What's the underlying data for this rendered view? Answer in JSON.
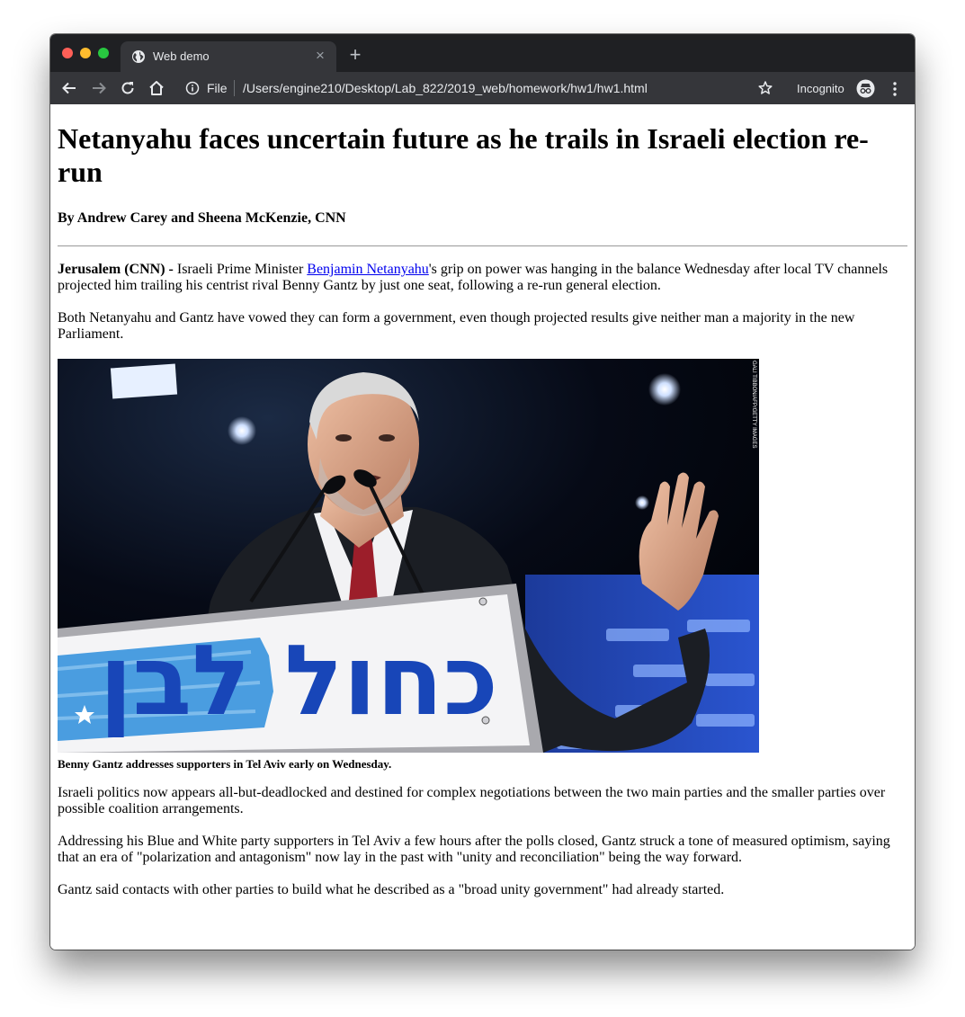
{
  "browser": {
    "tab": {
      "title": "Web demo",
      "close_icon": "close-icon",
      "favicon": "globe-icon"
    },
    "new_tab_icon": "plus-icon",
    "toolbar": {
      "back_icon": "back-arrow-icon",
      "forward_icon": "forward-arrow-icon",
      "reload_icon": "reload-icon",
      "home_icon": "home-icon"
    },
    "omnibox": {
      "scheme_label": "File",
      "url": "/Users/engine210/Desktop/Lab_822/2019_web/homework/hw1/hw1.html",
      "bookmark_icon": "star-icon"
    },
    "profile": {
      "label": "Incognito",
      "icon": "incognito-icon"
    },
    "menu_icon": "kebab-menu-icon"
  },
  "article": {
    "headline": "Netanyahu faces uncertain future as he trails in Israeli election re-run",
    "byline": "By Andrew Carey and Sheena McKenzie, CNN",
    "p1": {
      "dateline": "Jerusalem (CNN) -",
      "before_link": " Israeli Prime Minister ",
      "link_text": "Benjamin Netanyahu",
      "after_link": "'s grip on power was hanging in the balance Wednesday after local TV channels projected him trailing his centrist rival Benny Gantz by just one seat, following a re-run general election."
    },
    "p2": "Both Netanyahu and Gantz have vowed they can form a government, even though projected results give neither man a majority in the new Parliament.",
    "photo": {
      "credit": "GALI TIBBON/AFP/GETTY IMAGES",
      "banner_text": "כחול לבן",
      "caption": "Benny Gantz addresses supporters in Tel Aviv early on Wednesday."
    },
    "p3": "Israeli politics now appears all-but-deadlocked and destined for complex negotiations between the two main parties and the smaller parties over possible coalition arrangements.",
    "p4": "Addressing his Blue and White party supporters in Tel Aviv a few hours after the polls closed, Gantz struck a tone of measured optimism, saying that an era of \"polarization and antagonism\" now lay in the past with \"unity and reconciliation\" being the way forward.",
    "p5": "Gantz said contacts with other parties to build what he described as a \"broad unity government\" had already started."
  },
  "colors": {
    "tabbar_bg": "#1f2023",
    "toolbar_bg": "#35363a",
    "link": "#0000ee",
    "banner_blue": "#1846b8"
  }
}
